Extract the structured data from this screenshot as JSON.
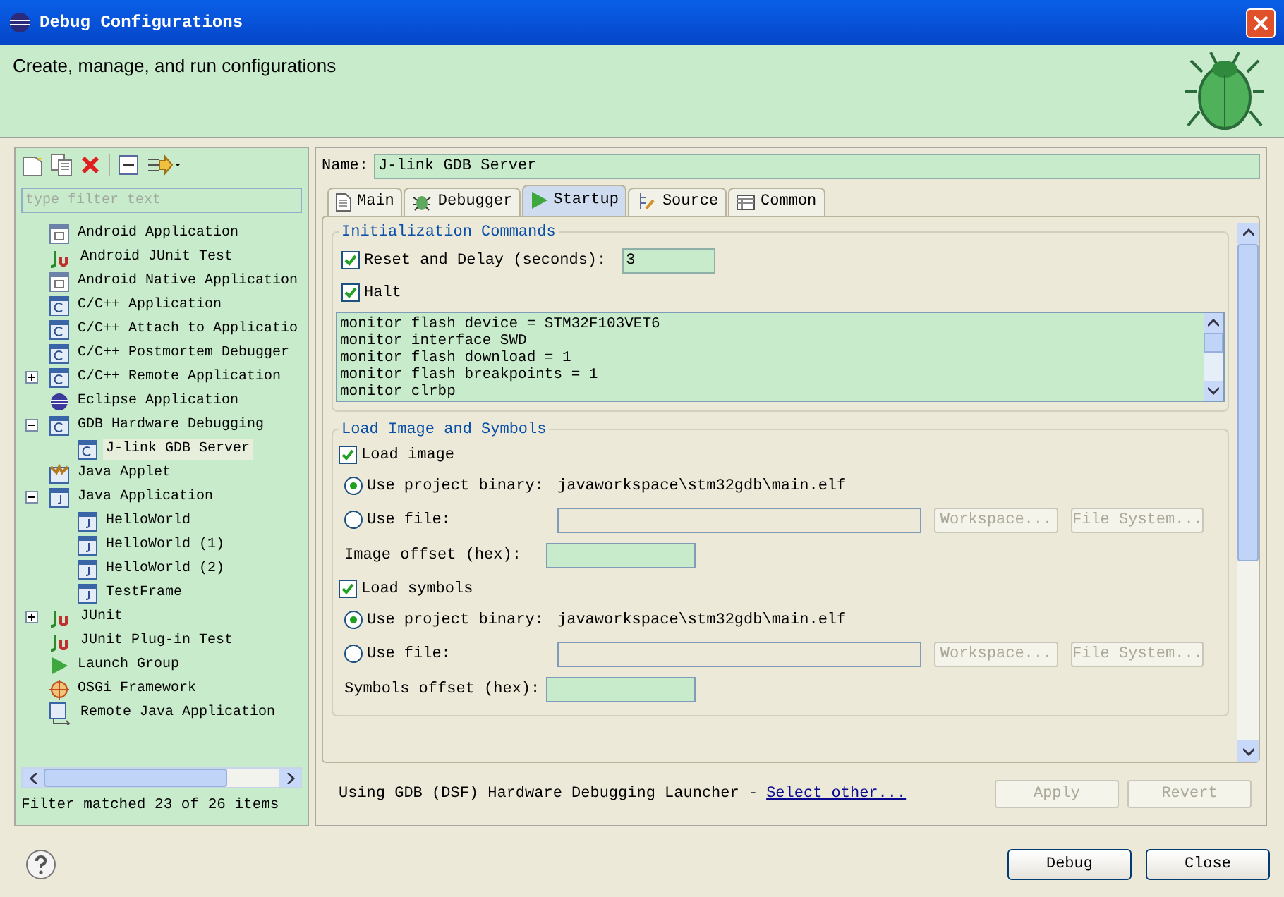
{
  "window": {
    "title": "Debug Configurations"
  },
  "header": {
    "text": "Create, manage, and run configurations"
  },
  "sidebar": {
    "filter": {
      "placeholder": "type filter text"
    },
    "tree": [
      {
        "label": "Android Application",
        "kind": "android",
        "selected": false
      },
      {
        "label": "Android JUnit Test",
        "kind": "junit",
        "selected": false
      },
      {
        "label": "Android Native Application",
        "kind": "android",
        "selected": false
      },
      {
        "label": "C/C++ Application",
        "kind": "cpp",
        "selected": false
      },
      {
        "label": "C/C++ Attach to Applicatio",
        "kind": "cpp",
        "selected": false
      },
      {
        "label": "C/C++ Postmortem Debugger",
        "kind": "cpp",
        "selected": false
      },
      {
        "label": "C/C++ Remote Application",
        "kind": "cpp",
        "selected": false,
        "expanded": false
      },
      {
        "label": "Eclipse Application",
        "kind": "eclipse",
        "selected": false
      },
      {
        "label": "GDB Hardware Debugging",
        "kind": "cpp",
        "selected": false,
        "expanded": true,
        "children": [
          {
            "label": "J-link GDB Server",
            "kind": "cpp",
            "selected": true
          }
        ]
      },
      {
        "label": "Java Applet",
        "kind": "applet",
        "selected": false
      },
      {
        "label": "Java Application",
        "kind": "java",
        "selected": false,
        "expanded": true,
        "children": [
          {
            "label": "HelloWorld",
            "kind": "java",
            "selected": false
          },
          {
            "label": "HelloWorld (1)",
            "kind": "java",
            "selected": false
          },
          {
            "label": "HelloWorld (2)",
            "kind": "java",
            "selected": false
          },
          {
            "label": "TestFrame",
            "kind": "java",
            "selected": false
          }
        ]
      },
      {
        "label": "JUnit",
        "kind": "junit",
        "selected": false,
        "expanded": false
      },
      {
        "label": "JUnit Plug-in Test",
        "kind": "junit",
        "selected": false
      },
      {
        "label": "Launch Group",
        "kind": "launch",
        "selected": false
      },
      {
        "label": "OSGi Framework",
        "kind": "osgi",
        "selected": false
      },
      {
        "label": "Remote Java Application",
        "kind": "remote",
        "selected": false
      }
    ],
    "status": "Filter matched 23 of 26 items"
  },
  "name_field": {
    "label": "Name:",
    "value": "J-link GDB Server"
  },
  "tabs": [
    {
      "label": "Main",
      "kind": "main",
      "selected": false
    },
    {
      "label": "Debugger",
      "kind": "debugger",
      "selected": false
    },
    {
      "label": "Startup",
      "kind": "startup",
      "selected": true
    },
    {
      "label": "Source",
      "kind": "source",
      "selected": false
    },
    {
      "label": "Common",
      "kind": "common",
      "selected": false
    }
  ],
  "init": {
    "title": "Initialization Commands",
    "reset": {
      "label": "Reset and Delay (seconds):",
      "checked": true,
      "value": "3"
    },
    "halt": {
      "label": "Halt",
      "checked": true
    },
    "commands": [
      "monitor flash device = STM32F103VET6",
      "monitor interface SWD",
      "monitor flash download = 1",
      "monitor flash breakpoints = 1",
      "monitor clrbp"
    ]
  },
  "load": {
    "title": "Load Image and Symbols",
    "groups": [
      {
        "check_label": "Load image",
        "checked": true,
        "project_label": "Use project binary:",
        "project_value": "javaworkspace\\stm32gdb\\main.elf",
        "project_selected": true,
        "file_label": "Use file:",
        "file_selected": false,
        "workspace_button": "Workspace...",
        "filesystem_button": "File System...",
        "offset_label": "Image offset (hex):"
      },
      {
        "check_label": "Load symbols",
        "checked": true,
        "project_label": "Use project binary:",
        "project_value": "javaworkspace\\stm32gdb\\main.elf",
        "project_selected": true,
        "file_label": "Use file:",
        "file_selected": false,
        "workspace_button": "Workspace...",
        "filesystem_button": "File System...",
        "offset_label": "Symbols offset (hex):"
      }
    ]
  },
  "launcher": {
    "text": "Using GDB (DSF) Hardware Debugging Launcher -",
    "link": "Select other..."
  },
  "panel_buttons": [
    {
      "label": "Apply",
      "disabled": true
    },
    {
      "label": "Revert",
      "disabled": true
    }
  ],
  "dialog_buttons": [
    {
      "label": "Debug"
    },
    {
      "label": "Close"
    }
  ]
}
